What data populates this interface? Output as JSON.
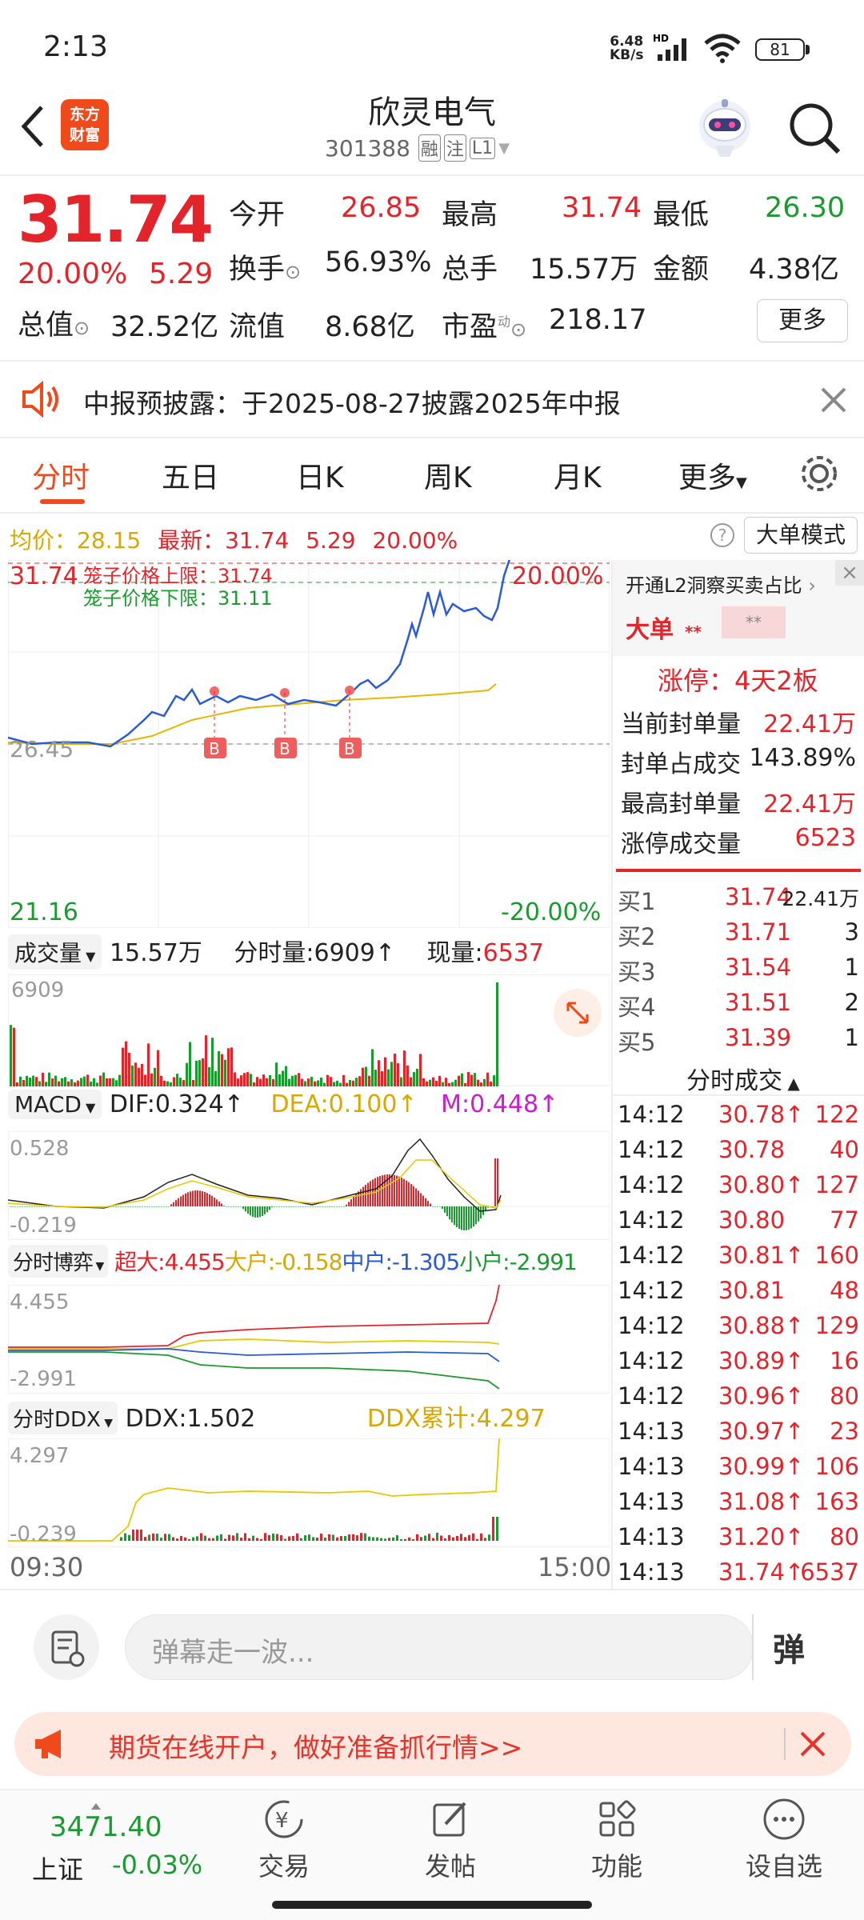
{
  "status": {
    "time": "2:13",
    "net_speed": "6.48",
    "net_unit": "KB/s",
    "battery": "81"
  },
  "header": {
    "title": "欣灵电气",
    "code": "301388",
    "tags": [
      "融",
      "注",
      "L1"
    ],
    "logo_line1": "东方",
    "logo_line2": "财富"
  },
  "quote": {
    "price": "31.74",
    "pct": "20.00%",
    "chg": "5.29",
    "open_label": "今开",
    "open": "26.85",
    "high_label": "最高",
    "high": "31.74",
    "low_label": "最低",
    "low": "26.30",
    "turnover_label": "换手",
    "turnover": "56.93%",
    "volume_label": "总手",
    "volume": "15.57万",
    "amount_label": "金额",
    "amount": "4.38亿",
    "mktcap_label": "总值",
    "mktcap": "32.52亿",
    "float_label": "流值",
    "float": "8.68亿",
    "pe_label": "市盈",
    "pe_sup": "动",
    "pe": "218.17",
    "more": "更多"
  },
  "notice": {
    "text": "中报预披露：于2025-08-27披露2025年中报"
  },
  "tabs": [
    "分时",
    "五日",
    "日K",
    "周K",
    "月K",
    "更多"
  ],
  "chart_info": {
    "avg_label": "均价：",
    "avg": "28.15",
    "latest_label": "最新：",
    "latest": "31.74",
    "chg": "5.29",
    "pct": "20.00%",
    "mode": "大单模式"
  },
  "price_chart": {
    "top_price": "31.74",
    "top_pct": "20.00%",
    "bottom_price": "21.16",
    "bottom_pct": "-20.00%",
    "mid_price": "26.45",
    "cage_upper": "笼子价格上限：31.74",
    "cage_lower": "笼子价格下限：31.11",
    "buy_marker": "B",
    "time_start": "09:30",
    "time_end": "15:00"
  },
  "volume_panel": {
    "selector": "成交量",
    "total": "15.57万",
    "minute_vol": "分时量:6909↑",
    "current_label": "现量:",
    "current": "6537",
    "axis_max": "6909"
  },
  "macd_panel": {
    "selector": "MACD",
    "dif": "DIF:0.324↑",
    "dea": "DEA:0.100↑",
    "m": "M:0.448↑",
    "axis_max": "0.528",
    "axis_min": "-0.219"
  },
  "game_panel": {
    "selector": "分时博弈",
    "super": "超大:4.455",
    "large": "大户:-0.158",
    "mid": "中户:-1.305",
    "small": "小户:-2.991",
    "axis_max": "4.455",
    "axis_min": "-2.991"
  },
  "ddx_panel": {
    "selector": "分时DDX",
    "ddx": "DDX:1.502",
    "ddx_sum": "DDX累计:4.297",
    "axis_max": "4.297",
    "axis_min": "-0.239"
  },
  "side": {
    "open_l2": "开通L2洞察买卖占比",
    "big_label": "大单",
    "stars": "**",
    "stars2": "**",
    "limit_label": "涨停：",
    "limit_value": "4天2板",
    "stats": [
      {
        "label": "当前封单量",
        "value": "22.41万"
      },
      {
        "label": "封单占成交",
        "value": "143.89%"
      },
      {
        "label": "最高封单量",
        "value": "22.41万"
      },
      {
        "label": "涨停成交量",
        "value": "6523"
      }
    ],
    "bids": [
      {
        "label": "买1",
        "price": "31.74",
        "vol": "22.41万"
      },
      {
        "label": "买2",
        "price": "31.71",
        "vol": "3"
      },
      {
        "label": "买3",
        "price": "31.54",
        "vol": "1"
      },
      {
        "label": "买4",
        "price": "31.51",
        "vol": "2"
      },
      {
        "label": "买5",
        "price": "31.39",
        "vol": "1"
      }
    ],
    "trades_title": "分时成交",
    "trades": [
      {
        "t": "14:12",
        "p": "30.78↑",
        "v": "122"
      },
      {
        "t": "14:12",
        "p": "30.78",
        "v": "40"
      },
      {
        "t": "14:12",
        "p": "30.80↑",
        "v": "127"
      },
      {
        "t": "14:12",
        "p": "30.80",
        "v": "77"
      },
      {
        "t": "14:12",
        "p": "30.81↑",
        "v": "160"
      },
      {
        "t": "14:12",
        "p": "30.81",
        "v": "48"
      },
      {
        "t": "14:12",
        "p": "30.88↑",
        "v": "129"
      },
      {
        "t": "14:12",
        "p": "30.89↑",
        "v": "16"
      },
      {
        "t": "14:12",
        "p": "30.96↑",
        "v": "80"
      },
      {
        "t": "14:13",
        "p": "30.97↑",
        "v": "23"
      },
      {
        "t": "14:13",
        "p": "30.99↑",
        "v": "106"
      },
      {
        "t": "14:13",
        "p": "31.08↑",
        "v": "163"
      },
      {
        "t": "14:13",
        "p": "31.20↑",
        "v": "80"
      },
      {
        "t": "14:13",
        "p": "31.74↑",
        "v": "6537"
      }
    ]
  },
  "comment": {
    "placeholder": "弹幕走一波...",
    "danmu_btn": "弹"
  },
  "ad": {
    "text": "期货在线开户，做好准备抓行情>>"
  },
  "bottom": {
    "index_value": "3471.40",
    "index_name": "上证",
    "index_chg": "-0.03%",
    "nav": [
      "交易",
      "发帖",
      "功能",
      "设自选"
    ]
  },
  "colors": {
    "up": "#e4242b",
    "down": "#1a9b2f",
    "accent": "#f04a1c",
    "avg_line": "#e6b800"
  }
}
